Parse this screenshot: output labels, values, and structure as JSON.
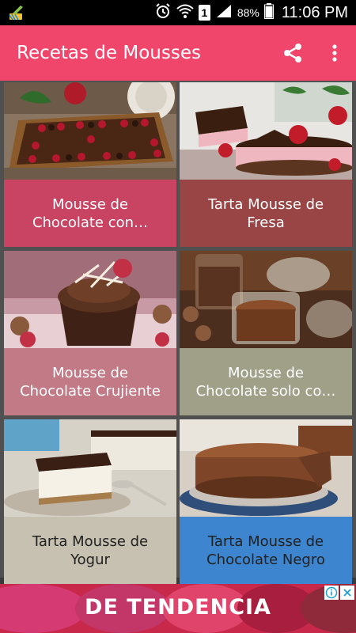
{
  "status_bar": {
    "notification_icon": "cleaner-broom-icon",
    "battery_percent": "88%",
    "sim_label": "1",
    "time": "11:06 PM"
  },
  "app_bar": {
    "title": "Recetas de Mousses",
    "share_icon": "share-icon",
    "menu_icon": "more-vert-icon",
    "color": "#f0466b"
  },
  "recipes": [
    {
      "title": "Mousse de Chocolate con…",
      "color": "#c94362"
    },
    {
      "title": "Tarta Mousse de Fresa",
      "color": "#9a4545"
    },
    {
      "title": "Mousse de Chocolate Crujiente",
      "color": "#c17a86"
    },
    {
      "title": "Mousse de Chocolate solo co…",
      "color": "#a0a088"
    },
    {
      "title": "Tarta Mousse de Yogur",
      "color": "#c6c1b0"
    },
    {
      "title": "Tarta Mousse de Chocolate Negro",
      "color": "#3d85cf"
    }
  ],
  "ad": {
    "text": "DE TENDENCIA",
    "info_icon": "adchoices-info-icon",
    "close_icon": "close-icon"
  }
}
